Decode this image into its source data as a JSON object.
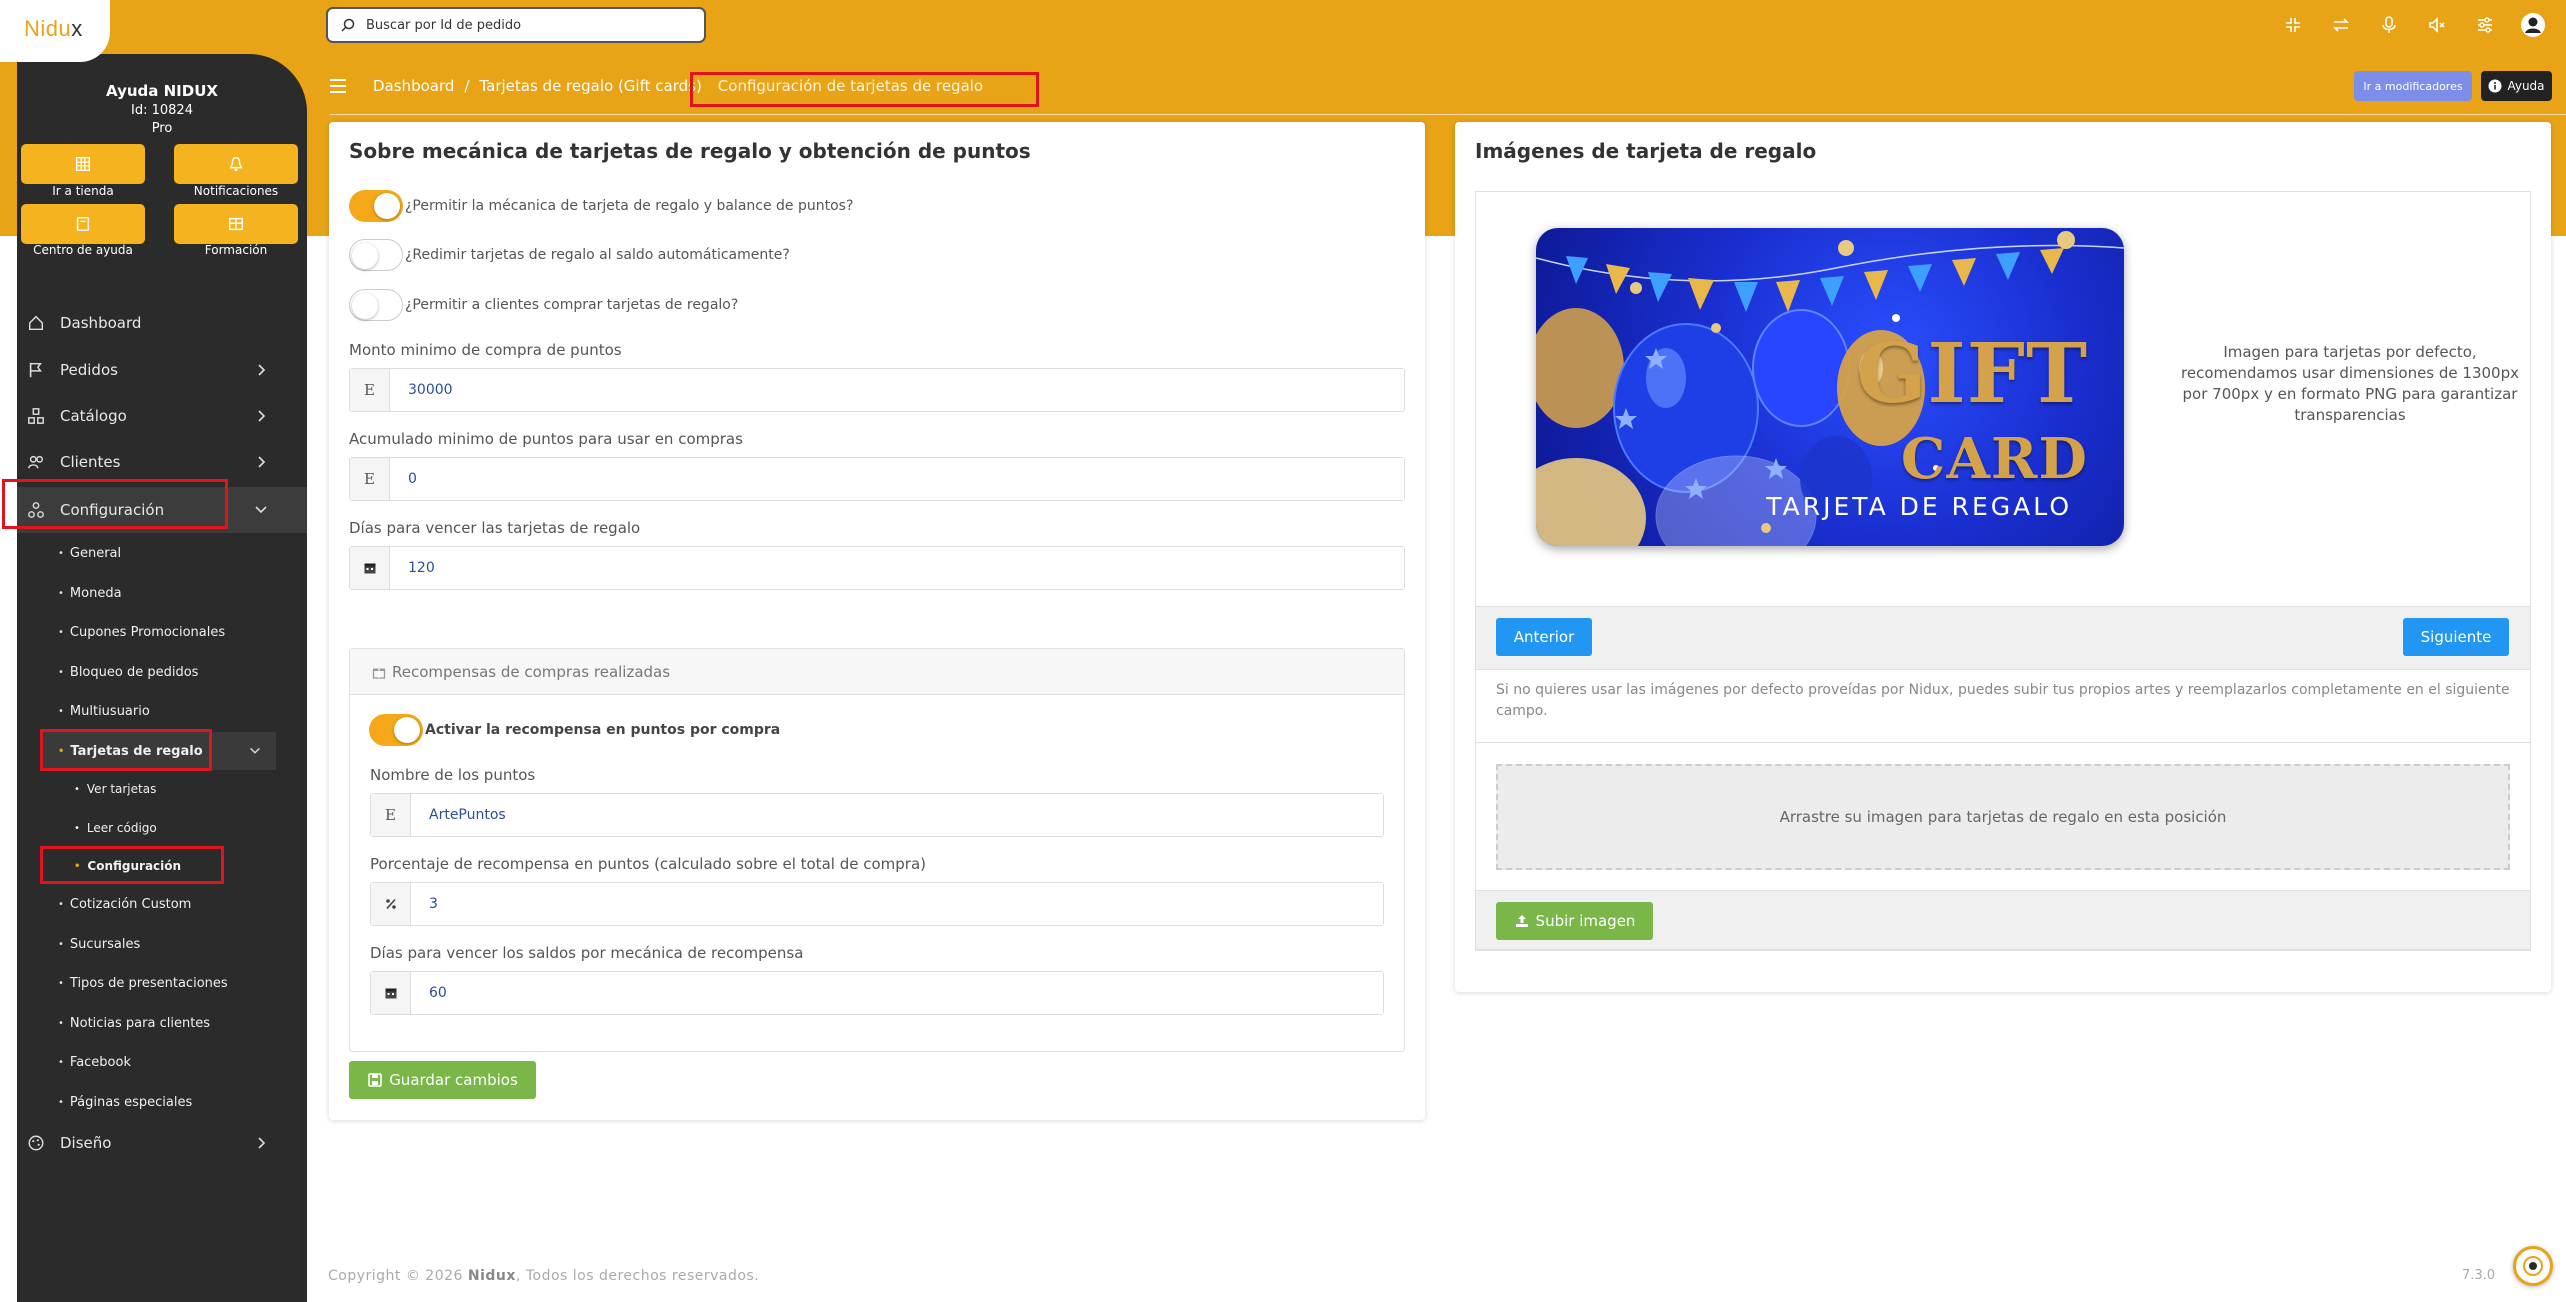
{
  "brand": {
    "logo_main": "Nidu",
    "logo_accent": "x"
  },
  "user": {
    "name": "Ayuda NIDUX",
    "id": "Id: 10824",
    "plan": "Pro"
  },
  "quick_actions": [
    {
      "label": "Ir a tienda",
      "icon": "store-icon"
    },
    {
      "label": "Notificaciones",
      "icon": "bell-icon"
    },
    {
      "label": "Centro de ayuda",
      "icon": "help-book-icon"
    },
    {
      "label": "Formación",
      "icon": "training-icon"
    }
  ],
  "search": {
    "placeholder": "Buscar por Id de pedido"
  },
  "nav": {
    "dashboard": "Dashboard",
    "pedidos": "Pedidos",
    "catalogo": "Catálogo",
    "clientes": "Clientes",
    "configuracion": "Configuración",
    "diseno": "Diseño",
    "sub": [
      "General",
      "Moneda",
      "Cupones Promocionales",
      "Bloqueo de pedidos",
      "Multiusuario",
      "Tarjetas de regalo",
      "Cotización Custom",
      "Sucursales",
      "Tipos de presentaciones",
      "Noticias para clientes",
      "Facebook",
      "Páginas especiales"
    ],
    "gift_sub": [
      "Ver tarjetas",
      "Leer código",
      "Configuración"
    ]
  },
  "breadcrumb": {
    "item1": "Dashboard",
    "item2": "Tarjetas de regalo (Gift cards)",
    "current": "Configuración de tarjetas de regalo"
  },
  "header_buttons": {
    "modifiers": "Ir a modificadores",
    "help": "Ayuda"
  },
  "left_card": {
    "title": "Sobre mecánica de tarjetas de regalo y obtención de puntos",
    "toggles": [
      {
        "label": "¿Permitir la mécanica de tarjeta de regalo y balance de puntos?",
        "on": true
      },
      {
        "label": "¿Redimir tarjetas de regalo al saldo automáticamente?",
        "on": false
      },
      {
        "label": "¿Permitir a clientes comprar tarjetas de regalo?",
        "on": false
      }
    ],
    "fields": [
      {
        "label": "Monto minimo de compra de puntos",
        "addon": "E",
        "value": "30000"
      },
      {
        "label": "Acumulado minimo de puntos para usar en compras",
        "addon": "E",
        "value": "0"
      },
      {
        "label": "Días para vencer las tarjetas de regalo",
        "addon": "calendar-icon",
        "value": "120"
      }
    ],
    "rewards": {
      "header": "Recompensas de compras realizadas",
      "toggle_label": "Activar la recompensa en puntos por compra",
      "fields": [
        {
          "label": "Nombre de los puntos",
          "addon": "E",
          "value": "ArtePuntos"
        },
        {
          "label": "Porcentaje de recompensa en puntos (calculado sobre el total de compra)",
          "addon": "percent-icon",
          "value": "3"
        },
        {
          "label": "Días para vencer los saldos por mecánica de recompensa",
          "addon": "calendar-icon",
          "value": "60"
        }
      ]
    },
    "save_button": "Guardar cambios"
  },
  "right_card": {
    "title": "Imágenes de tarjeta de regalo",
    "gift_card": {
      "line1": "GIFT",
      "line2": "CARD",
      "subtitle": "TARJETA DE REGALO"
    },
    "hint": "Imagen para tarjetas por defecto, recomendamos usar dimensiones de 1300px por 700px y en formato PNG para garantizar transparencias",
    "prev_button": "Anterior",
    "next_button": "Siguiente",
    "info": "Si no quieres usar las imágenes por defecto proveídas por Nidux, puedes subir tus propios artes y reemplazarlos completamente en el siguiente campo.",
    "dropzone": "Arrastre su imagen para tarjetas de regalo en esta posición",
    "upload_button": "Subir imagen"
  },
  "footer": {
    "prefix": "Copyright © 2026 ",
    "brand": "Nidux",
    "suffix": ", Todos los derechos reservados.",
    "version": "7.3.0"
  },
  "colors": {
    "accent": "#e8a317",
    "sidebar": "#2b2b2b",
    "green": "#7ab648",
    "blue": "#2196f3",
    "highlight": "#e0141e"
  }
}
